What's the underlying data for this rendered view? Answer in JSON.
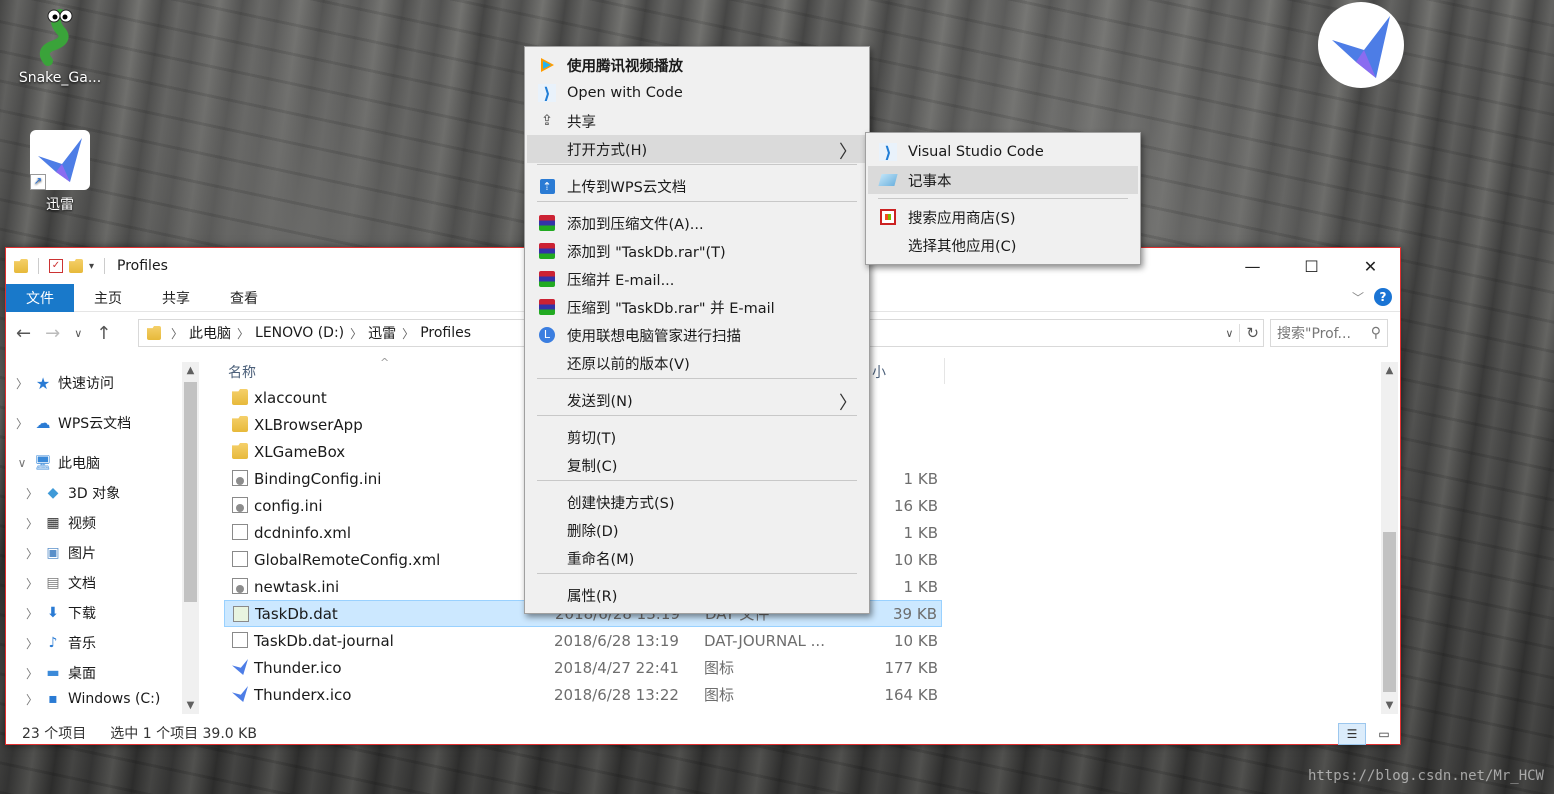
{
  "desktop": {
    "icons": [
      {
        "label": "Snake_Ga..."
      },
      {
        "label": "迅雷"
      }
    ],
    "watermark": "https://blog.csdn.net/Mr_HCW"
  },
  "window": {
    "title": "Profiles",
    "controls": {
      "minimize": "—",
      "maximize": "☐",
      "close": "✕"
    },
    "ribbon_tabs": [
      "文件",
      "主页",
      "共享",
      "查看"
    ],
    "address": {
      "crumbs": [
        "此电脑",
        "LENOVO (D:)",
        "迅雷",
        "Profiles"
      ]
    },
    "search": {
      "placeholder": "搜索\"Prof..."
    },
    "nav_items": [
      {
        "label": "快速访问"
      },
      {
        "label": "WPS云文档"
      },
      {
        "label": "此电脑"
      },
      {
        "label": "3D 对象"
      },
      {
        "label": "视频"
      },
      {
        "label": "图片"
      },
      {
        "label": "文档"
      },
      {
        "label": "下载"
      },
      {
        "label": "音乐"
      },
      {
        "label": "桌面"
      },
      {
        "label": "Windows (C:)"
      }
    ],
    "columns": {
      "name": "名称",
      "size_partial": "小"
    },
    "files": [
      {
        "name": "xlaccount",
        "date": "",
        "type": "",
        "size": "",
        "kind": "folder"
      },
      {
        "name": "XLBrowserApp",
        "date": "",
        "type": "",
        "size": "",
        "kind": "folder"
      },
      {
        "name": "XLGameBox",
        "date": "",
        "type": "",
        "size": "",
        "kind": "folder"
      },
      {
        "name": "BindingConfig.ini",
        "date": "",
        "type": "",
        "size": "1 KB",
        "kind": "cfg"
      },
      {
        "name": "config.ini",
        "date": "",
        "type": "",
        "size": "16 KB",
        "kind": "cfg"
      },
      {
        "name": "dcdninfo.xml",
        "date": "",
        "type": "",
        "size": "1 KB",
        "kind": "doc"
      },
      {
        "name": "GlobalRemoteConfig.xml",
        "date": "",
        "type": "",
        "size": "10 KB",
        "kind": "doc"
      },
      {
        "name": "newtask.ini",
        "date": "",
        "type": "",
        "size": "1 KB",
        "kind": "cfg"
      },
      {
        "name": "TaskDb.dat",
        "date": "2018/6/28 13:19",
        "type": "DAT 文件",
        "size": "39 KB",
        "kind": "dat",
        "selected": true
      },
      {
        "name": "TaskDb.dat-journal",
        "date": "2018/6/28 13:19",
        "type": "DAT-JOURNAL ...",
        "size": "10 KB",
        "kind": "doc"
      },
      {
        "name": "Thunder.ico",
        "date": "2018/4/27 22:41",
        "type": "图标",
        "size": "177 KB",
        "kind": "bird"
      },
      {
        "name": "Thunderx.ico",
        "date": "2018/6/28 13:22",
        "type": "图标",
        "size": "164 KB",
        "kind": "bird"
      }
    ],
    "status": {
      "count": "23 个项目",
      "selected": "选中 1 个项目  39.0 KB"
    }
  },
  "context_menu": {
    "items": [
      {
        "label": "使用腾讯视频播放",
        "icon": "tencent-video-icon"
      },
      {
        "label": "Open with Code",
        "icon": "vscode-icon"
      },
      {
        "label": "共享",
        "icon": "share-icon"
      },
      {
        "label": "打开方式(H)",
        "icon": ""
      },
      {
        "label": "上传到WPS云文档",
        "icon": "wps-cloud-icon"
      },
      {
        "label": "添加到压缩文件(A)...",
        "icon": "winrar-icon"
      },
      {
        "label": "添加到 \"TaskDb.rar\"(T)",
        "icon": "winrar-icon"
      },
      {
        "label": "压缩并 E-mail...",
        "icon": "winrar-icon"
      },
      {
        "label": "压缩到 \"TaskDb.rar\" 并 E-mail",
        "icon": "winrar-icon"
      },
      {
        "label": "使用联想电脑管家进行扫描",
        "icon": "lenovo-icon"
      },
      {
        "label": "还原以前的版本(V)",
        "icon": ""
      },
      {
        "label": "发送到(N)",
        "icon": ""
      },
      {
        "label": "剪切(T)",
        "icon": ""
      },
      {
        "label": "复制(C)",
        "icon": ""
      },
      {
        "label": "创建快捷方式(S)",
        "icon": ""
      },
      {
        "label": "删除(D)",
        "icon": ""
      },
      {
        "label": "重命名(M)",
        "icon": ""
      },
      {
        "label": "属性(R)",
        "icon": ""
      }
    ]
  },
  "submenu": {
    "items": [
      {
        "label": "Visual Studio Code",
        "icon": "vscode-icon"
      },
      {
        "label": "记事本",
        "icon": "notepad-icon"
      },
      {
        "label": "搜索应用商店(S)",
        "icon": "store-icon"
      },
      {
        "label": "选择其他应用(C)",
        "icon": ""
      }
    ]
  },
  "colors": {
    "accent": "#1979ca",
    "selection": "#cce8ff",
    "window_border": "#e02f2f"
  }
}
